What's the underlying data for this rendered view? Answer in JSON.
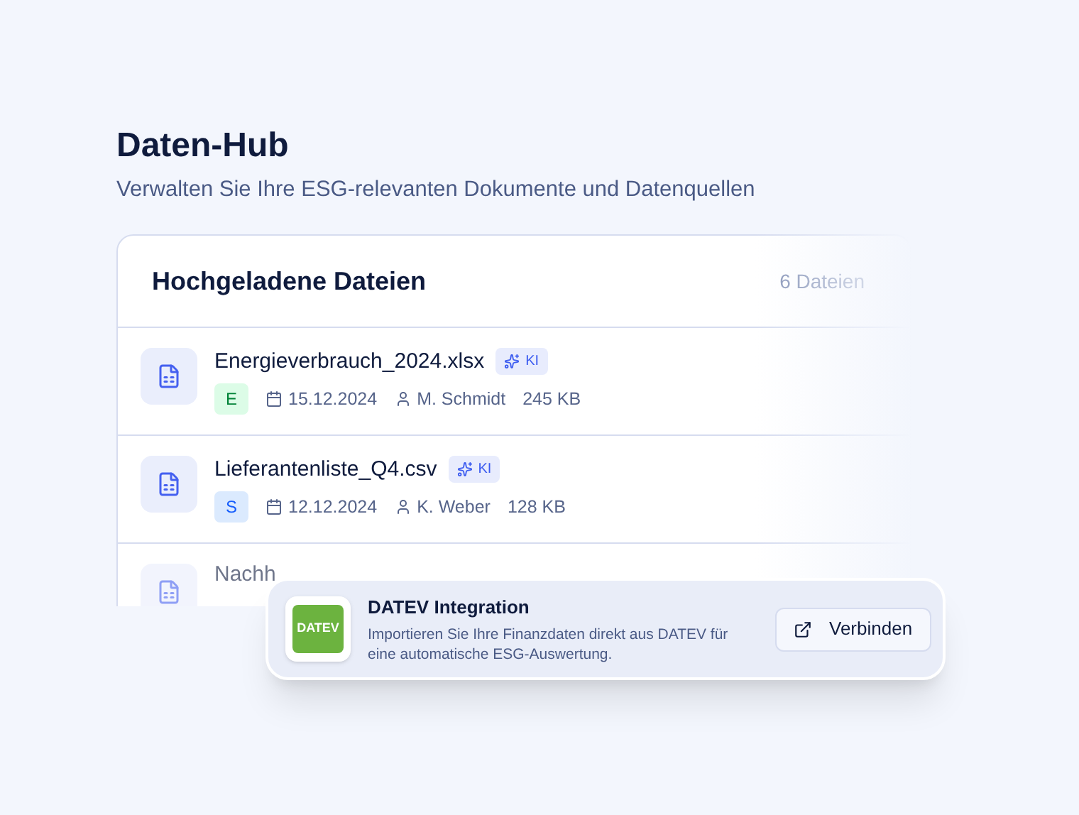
{
  "header": {
    "title": "Daten-Hub",
    "subtitle": "Verwalten Sie Ihre ESG-relevanten Dokumente und Datenquellen"
  },
  "files_panel": {
    "title": "Hochgeladene Dateien",
    "count": "6 Dateien",
    "files": [
      {
        "name": "Energieverbrauch_2024.xlsx",
        "ai_badge": "KI",
        "category": "E",
        "color": "#dcfce7",
        "date": "15.12.2024",
        "owner": "M. Schmidt",
        "size": "245 KB"
      },
      {
        "name": "Lieferantenliste_Q4.csv",
        "ai_badge": "KI",
        "category": "S",
        "color": "#dbeafe",
        "date": "12.12.2024",
        "owner": "K. Weber",
        "size": "128 KB"
      },
      {
        "name": "Nachh"
      }
    ]
  },
  "integration": {
    "logo": "DATEV",
    "title": "DATEV Integration",
    "description": "Importieren Sie Ihre Finanzdaten direkt aus DATEV für eine automatische ESG-Auswertung.",
    "button": "Verbinden"
  }
}
